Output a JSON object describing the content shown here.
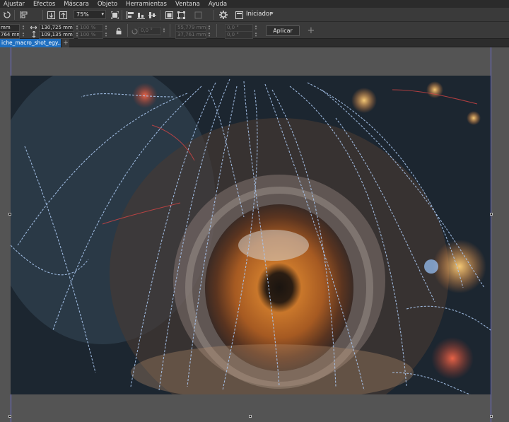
{
  "menu": [
    "Ajustar",
    "Efectos",
    "Máscara",
    "Objeto",
    "Herramientas",
    "Ventana",
    "Ayuda"
  ],
  "toolbar": {
    "zoom": "75%",
    "workspace_label": "Iniciador"
  },
  "props": {
    "w_value": "mm",
    "h_value": "764 mm",
    "x_value": "130,725 mm",
    "y_value": "109,135 mm",
    "scale_x": "100 %",
    "scale_y": "100 %",
    "rotation": "0,0 °",
    "pos2_x": "55,779 mm",
    "pos2_y": "37,761 mm",
    "skew_x": "0,0 °",
    "skew_y": "0,0 °",
    "apply_label": "Aplicar"
  },
  "document": {
    "tab_title": "iche_macro_shot_egy...*"
  },
  "colors": {
    "tab_active": "#1f6fc0",
    "selection_outline": "#5b8ed8",
    "canvas_bg": "#545454"
  }
}
